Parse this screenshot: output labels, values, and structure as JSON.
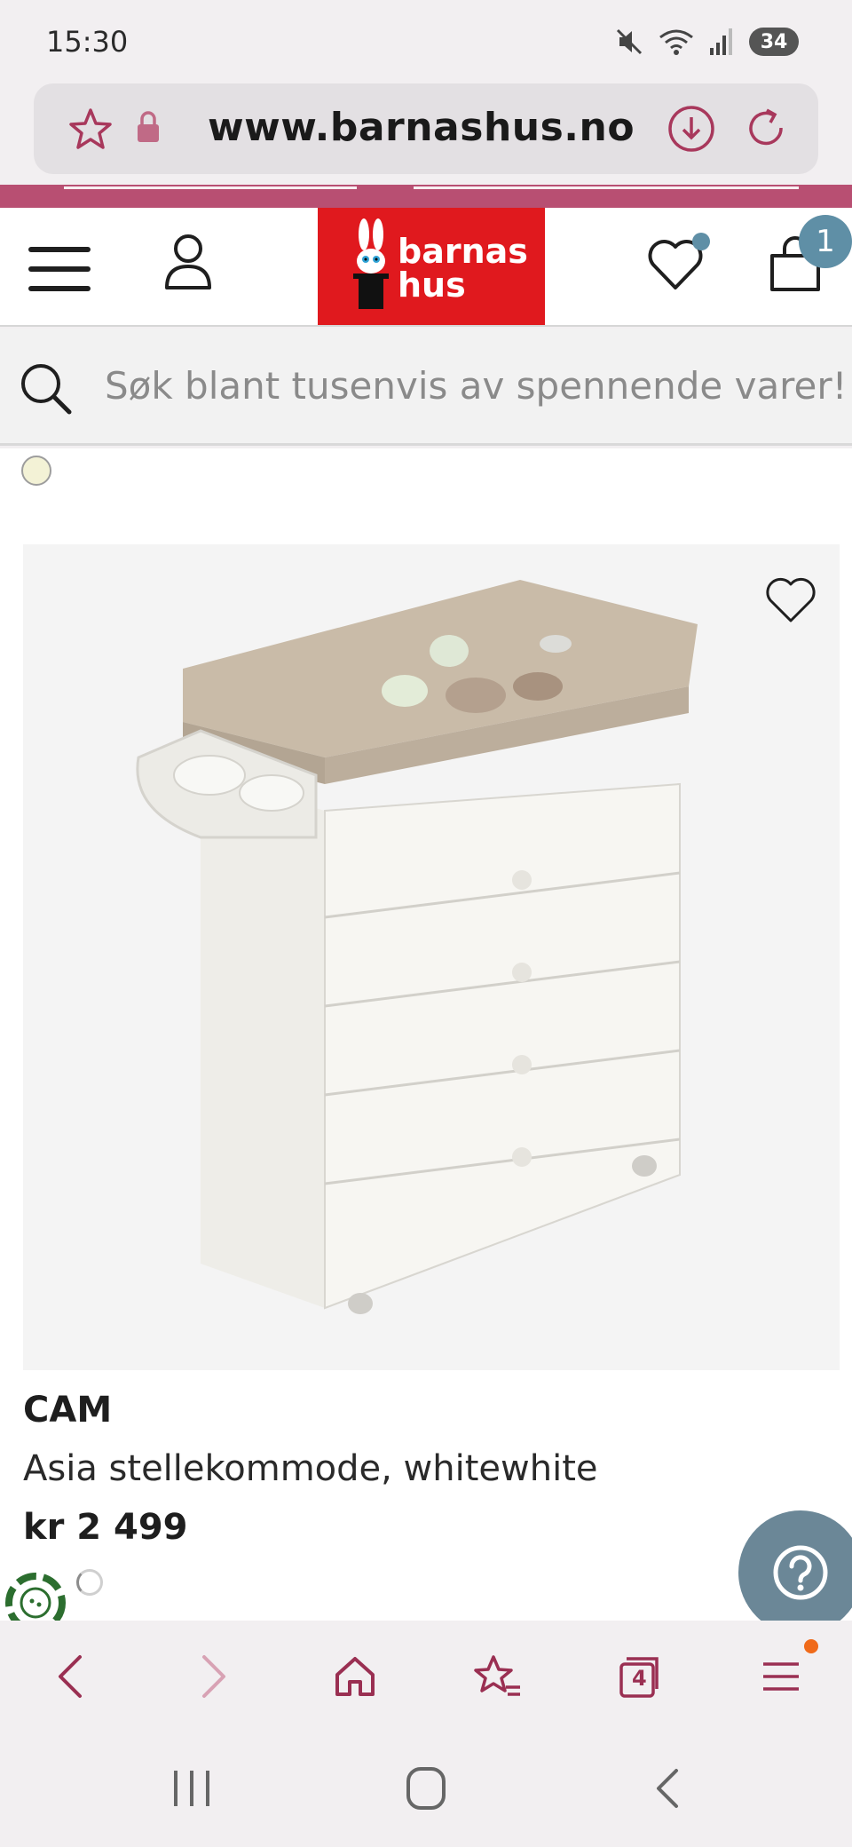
{
  "status_bar": {
    "time": "15:30",
    "battery": "34",
    "icons": [
      "mute-icon",
      "wifi-icon",
      "signal-icon"
    ]
  },
  "browser": {
    "url": "www.barnashus.no",
    "icons": [
      "star-icon",
      "lock-icon",
      "download-icon",
      "reload-icon"
    ]
  },
  "header": {
    "logo_line1": "barnas",
    "logo_line2": "hus",
    "cart_count": "1",
    "icons": [
      "menu-icon",
      "user-icon",
      "heart-icon",
      "cart-icon"
    ],
    "brand_color": "#e0191e",
    "accent_color": "#b84f72"
  },
  "search": {
    "placeholder": "Søk blant tusenvis av spennende varer!"
  },
  "product": {
    "brand": "CAM",
    "title": "Asia stellekommode, whitewhite",
    "price": "kr 2 499",
    "color_swatch": "#f3f2d6"
  },
  "help": {
    "icon": "question-icon"
  },
  "bottom_bar": {
    "tab_count": "4",
    "icons": [
      "back-icon",
      "forward-icon",
      "home-icon",
      "bookmarks-icon",
      "tabs-icon",
      "menu-icon"
    ]
  },
  "android_nav": {
    "icons": [
      "recents-icon",
      "home-circle-icon",
      "back-chevron-icon"
    ]
  }
}
